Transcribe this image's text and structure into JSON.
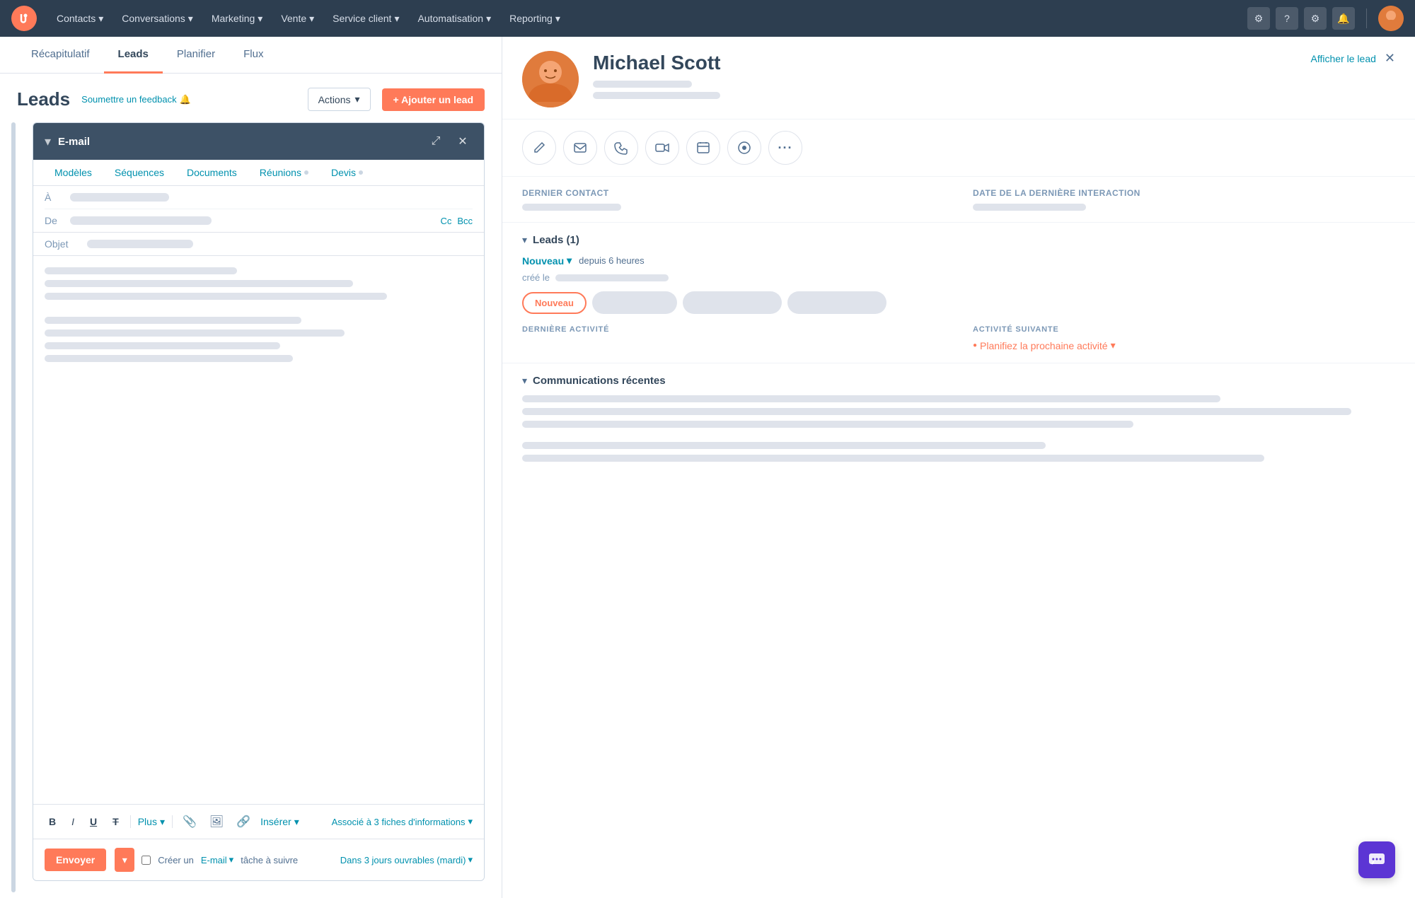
{
  "nav": {
    "items": [
      {
        "label": "Contacts",
        "id": "contacts"
      },
      {
        "label": "Conversations",
        "id": "conversations"
      },
      {
        "label": "Marketing",
        "id": "marketing"
      },
      {
        "label": "Vente",
        "id": "vente"
      },
      {
        "label": "Service client",
        "id": "service-client"
      },
      {
        "label": "Automatisation",
        "id": "automatisation"
      },
      {
        "label": "Reporting",
        "id": "reporting"
      }
    ]
  },
  "tabs": [
    {
      "label": "Récapitulatif",
      "id": "recapitulatif"
    },
    {
      "label": "Leads",
      "id": "leads",
      "active": true
    },
    {
      "label": "Planifier",
      "id": "planifier"
    },
    {
      "label": "Flux",
      "id": "flux"
    }
  ],
  "leads_header": {
    "title": "Leads",
    "feedback_label": "Soumettre un feedback",
    "actions_label": "Actions",
    "add_lead_label": "+ Ajouter un lead"
  },
  "email_compose": {
    "header_title": "E-mail",
    "tabs": [
      {
        "label": "Modèles"
      },
      {
        "label": "Séquences"
      },
      {
        "label": "Documents"
      },
      {
        "label": "Réunions",
        "dot": true
      },
      {
        "label": "Devis",
        "dot": true
      }
    ],
    "fields": {
      "to_label": "À",
      "from_label": "De",
      "cc_label": "Cc",
      "bcc_label": "Bcc",
      "subject_label": "Objet"
    },
    "toolbar": {
      "bold": "B",
      "italic": "I",
      "underline": "U",
      "strikethrough": "T",
      "more_label": "Plus",
      "insert_label": "Insérer",
      "associate_label": "Associé à 3 fiches d'informations"
    },
    "send_row": {
      "send_label": "Envoyer",
      "creer_label": "Créer un",
      "email_tag_label": "E-mail",
      "task_label": "tâche à suivre",
      "days_label": "Dans 3 jours ouvrables (mardi)"
    }
  },
  "contact": {
    "name": "Michael Scott",
    "afficher_label": "Afficher le lead",
    "details": {
      "dernier_contact_label": "Dernier contact",
      "derniere_interaction_label": "Date de la dernière interaction"
    }
  },
  "leads_section": {
    "title": "Leads (1)",
    "status_label": "Nouveau",
    "since_label": "depuis 6 heures",
    "created_label": "créé le",
    "status_pills": [
      "Nouveau"
    ],
    "activity": {
      "derniere_label": "DERNIÈRE ACTIVITÉ",
      "suivante_label": "ACTIVITÉ SUIVANTE",
      "planifier_label": "Planifiez la prochaine activité"
    }
  },
  "comms_section": {
    "title": "Communications récentes"
  },
  "colors": {
    "accent": "#ff7a59",
    "link": "#0091ae",
    "nav_bg": "#2d3e50",
    "chat_btn": "#5c35d4"
  }
}
